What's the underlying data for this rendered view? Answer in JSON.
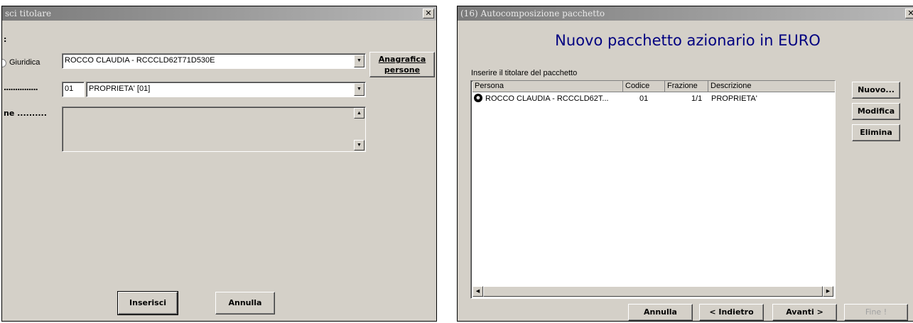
{
  "left_dialog": {
    "title": "sci titolare",
    "label_colon": ":",
    "radio_label": "Giuridica",
    "person_value": "ROCCO CLAUDIA - RCCCLD62T71D530E",
    "anagrafica_label_line1": "Anagrafica",
    "anagrafica_label_line2": "persone",
    "row2_label": "...............",
    "code_value": "01",
    "type_value": "PROPRIETA' [01]",
    "row3_label": "ne ..........",
    "inserisci_label": "Inserisci",
    "annulla_label": "Annulla"
  },
  "right_dialog": {
    "title": "(16) Autocomposizione pacchetto",
    "heading": "Nuovo pacchetto azionario in EURO",
    "instruction": "Inserire il titolare del pacchetto",
    "columns": [
      "Persona",
      "Codice",
      "Frazione",
      "Descrizione"
    ],
    "rows": [
      {
        "persona": "ROCCO CLAUDIA - RCCCLD62T...",
        "codice": "01",
        "frazione": "1/1",
        "descrizione": "PROPRIETA'"
      }
    ],
    "side_buttons": {
      "nuovo": "Nuovo...",
      "modifica": "Modifica",
      "elimina": "Elimina"
    },
    "footer": {
      "annulla": "Annulla",
      "indietro": "< Indietro",
      "avanti": "Avanti >",
      "fine": "Fine !"
    }
  },
  "colors": {
    "dialog_bg": "#d4d0c8",
    "heading_color": "#000080",
    "title_gradient_start": "#7a7a7a"
  }
}
